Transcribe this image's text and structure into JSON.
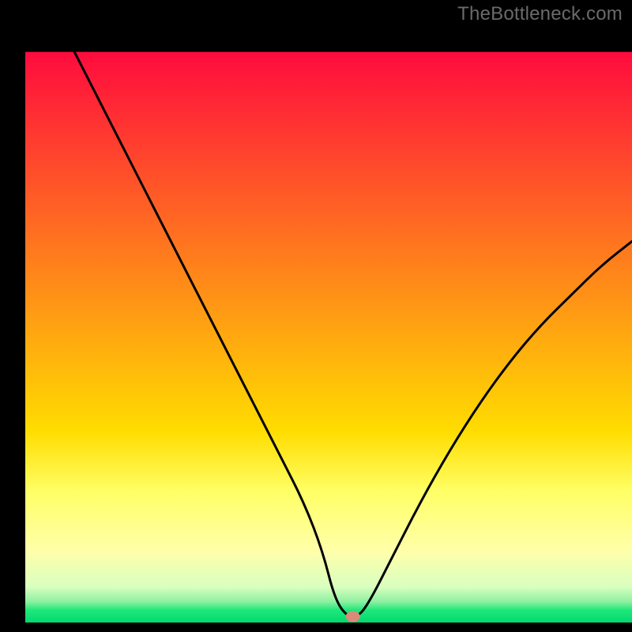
{
  "watermark": "TheBottleneck.com",
  "chart_data": {
    "type": "line",
    "title": "",
    "xlabel": "",
    "ylabel": "",
    "xlim": [
      0,
      100
    ],
    "ylim": [
      0,
      100
    ],
    "x": [
      6,
      10,
      14,
      18,
      22,
      26,
      30,
      34,
      38,
      42,
      46,
      49,
      51,
      53,
      55,
      57,
      60,
      65,
      70,
      75,
      80,
      85,
      90,
      95,
      100
    ],
    "values": [
      100,
      92,
      84,
      76,
      68,
      60,
      52,
      44,
      36,
      28,
      20,
      12,
      4,
      1,
      1,
      4,
      10,
      20,
      29,
      37,
      44,
      50,
      55,
      60,
      64
    ],
    "marker": {
      "x": 54,
      "y": 1
    },
    "gradient_bands": [
      {
        "y0": 4.2,
        "y1": 68,
        "from": "#ff0b3e",
        "to": "#ffdd00"
      },
      {
        "y0": 68,
        "y1": 78,
        "from": "#ffdd00",
        "to": "#ffff66"
      },
      {
        "y0": 78,
        "y1": 88,
        "from": "#ffff66",
        "to": "#ffffaa"
      },
      {
        "y0": 88,
        "y1": 94,
        "from": "#ffffaa",
        "to": "#d9ffc0"
      },
      {
        "y0": 94,
        "y1": 96.5,
        "from": "#d9ffc0",
        "to": "#8cf0a0"
      },
      {
        "y0": 96.5,
        "y1": 97.8,
        "from": "#8cf0a0",
        "to": "#22e87a"
      },
      {
        "y0": 97.8,
        "y1": 100,
        "from": "#22e87a",
        "to": "#00d870"
      }
    ],
    "colors": {
      "curve": "#000000",
      "marker_fill": "#d98b7a",
      "marker_stroke": "#8f5a4a",
      "frame": "#000000"
    }
  }
}
